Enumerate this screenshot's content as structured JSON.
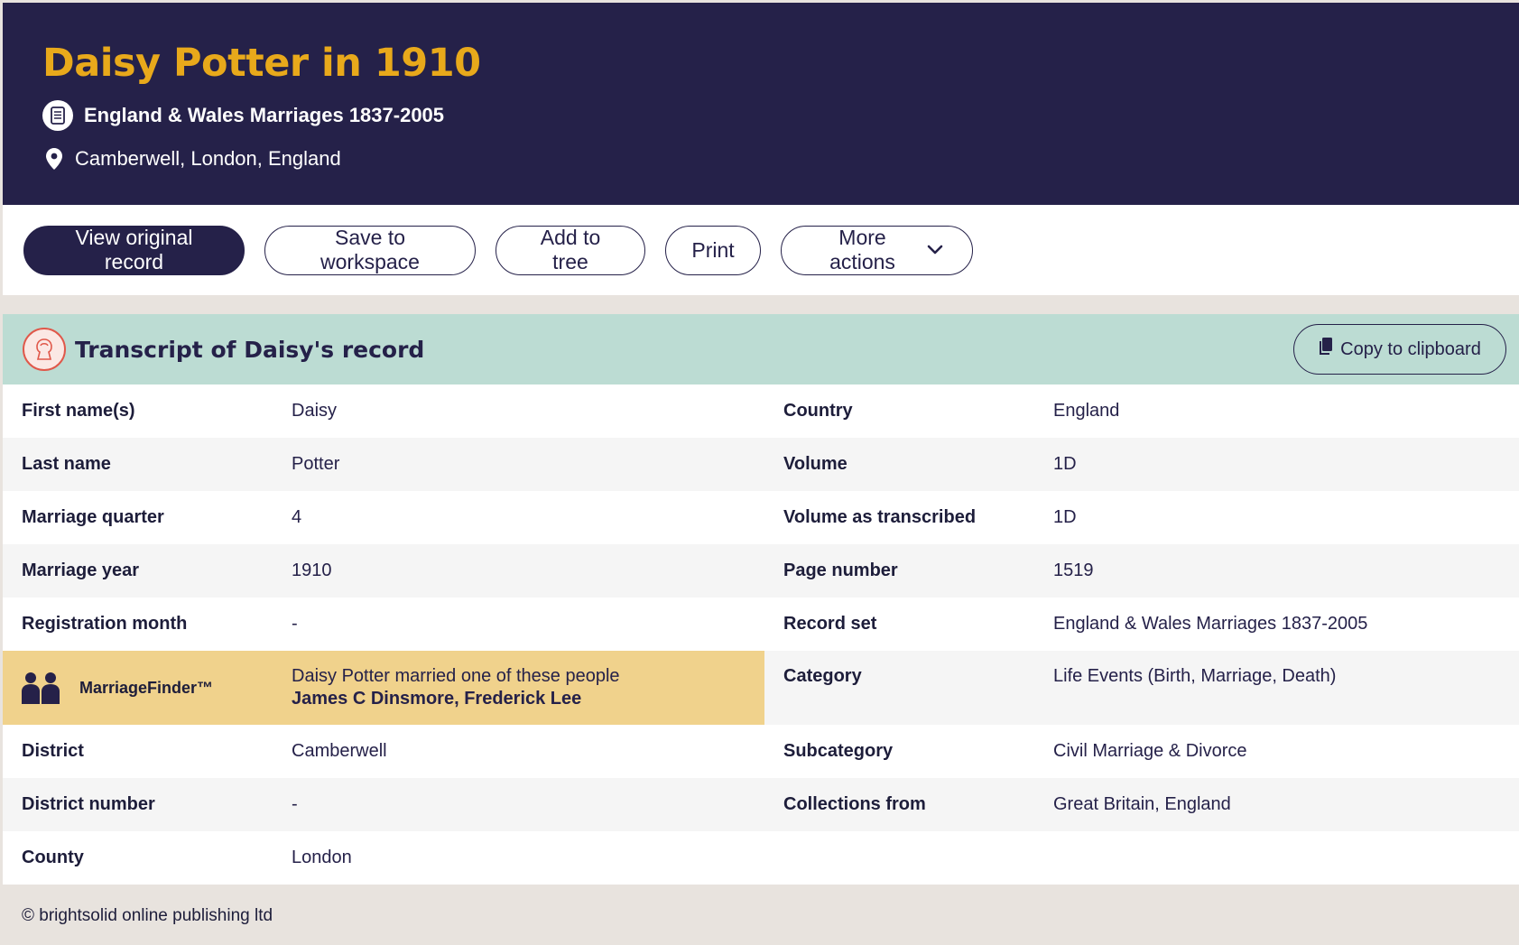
{
  "header": {
    "title": "Daisy Potter in 1910",
    "collection": "England & Wales Marriages 1837-2005",
    "location": "Camberwell, London, England"
  },
  "actions": {
    "view_original": "View original record",
    "save_workspace": "Save to workspace",
    "add_tree": "Add to tree",
    "print": "Print",
    "more_actions": "More actions"
  },
  "transcript": {
    "title": "Transcript of Daisy's record",
    "copy_label": "Copy to clipboard",
    "left": [
      {
        "label": "First name(s)",
        "value": "Daisy"
      },
      {
        "label": "Last name",
        "value": "Potter"
      },
      {
        "label": "Marriage quarter",
        "value": "4"
      },
      {
        "label": "Marriage year",
        "value": "1910"
      },
      {
        "label": "Registration month",
        "value": "-"
      },
      {
        "label": "District",
        "value": "Camberwell"
      },
      {
        "label": "District number",
        "value": "-"
      },
      {
        "label": "County",
        "value": "London"
      }
    ],
    "right": [
      {
        "label": "Country",
        "value": "England"
      },
      {
        "label": "Volume",
        "value": "1D"
      },
      {
        "label": "Volume as transcribed",
        "value": "1D"
      },
      {
        "label": "Page number",
        "value": "1519"
      },
      {
        "label": "Record set",
        "value": "England & Wales Marriages 1837-2005"
      },
      {
        "label": "Category",
        "value": "Life Events (Birth, Marriage, Death)"
      },
      {
        "label": "Subcategory",
        "value": "Civil Marriage & Divorce"
      },
      {
        "label": "Collections from",
        "value": "Great Britain, England"
      }
    ],
    "marriage_finder": {
      "label": "MarriageFinder™",
      "text": "Daisy Potter married one of these people",
      "names": "James C Dinsmore, Frederick Lee"
    }
  },
  "footer": {
    "copyright": "© brightsolid online publishing ltd"
  },
  "colors": {
    "navy": "#252149",
    "gold": "#e8a91b",
    "teal": "#bcdcd3",
    "marriage_finder_bg": "#f0d28c"
  }
}
